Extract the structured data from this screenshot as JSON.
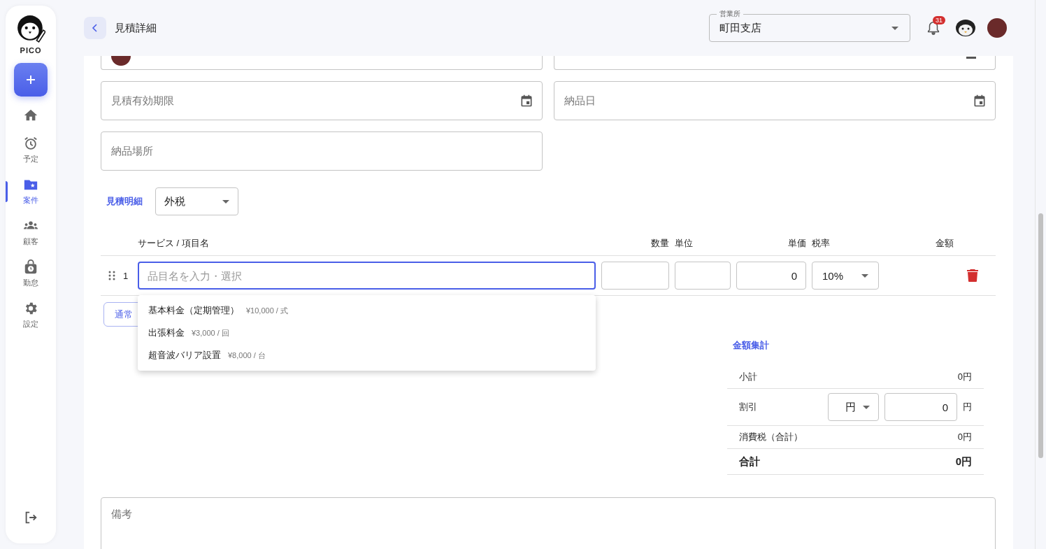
{
  "sidebar": {
    "logo_text": "PICO",
    "nav": [
      {
        "kind": "home",
        "selected": false
      },
      {
        "kind": "alarm",
        "label": "予定",
        "selected": false
      },
      {
        "kind": "folder",
        "label": "案件",
        "selected": true
      },
      {
        "kind": "people",
        "label": "顧客",
        "selected": false
      },
      {
        "kind": "timecard",
        "label": "勤怠",
        "selected": false
      },
      {
        "kind": "gear",
        "label": "設定",
        "selected": false
      }
    ]
  },
  "header": {
    "title": "見積詳細",
    "branch_select": {
      "label": "営業所",
      "value": "町田支店"
    },
    "notification_count": "31"
  },
  "partial_fields": [
    {
      "kind": "person"
    },
    {
      "kind": "date"
    }
  ],
  "fields": [
    {
      "kind": "date",
      "placeholder": "見積有効期限"
    },
    {
      "kind": "date",
      "placeholder": "納品日"
    },
    {
      "kind": "text",
      "placeholder": "納品場所"
    }
  ],
  "line_items": {
    "title": "見積明細",
    "tax_mode": "外税",
    "columns": [
      "サービス / 項目名",
      "数量",
      "単位",
      "単価",
      "税率",
      "金額"
    ],
    "rows": [
      {
        "number": "1",
        "name_placeholder": "品目名を入力・選択",
        "focused": true,
        "unit_price": "0",
        "tax_rate": "10%"
      }
    ],
    "suggestions": [
      {
        "name": "基本料金（定期管理）",
        "price": "¥10,000 / 式"
      },
      {
        "name": "出張料金",
        "price": "¥3,000 / 回"
      },
      {
        "name": "超音波バリア設置",
        "price": "¥8,000 / 台"
      }
    ],
    "add_button": "通常"
  },
  "summary": {
    "title": "金額集計",
    "rows": [
      {
        "kind": "plain",
        "label": "小計",
        "value": "0円"
      },
      {
        "kind": "discount",
        "label": "割引",
        "unit_select": "円",
        "value": "0",
        "unit": "円"
      },
      {
        "kind": "plain",
        "label": "消費税（合計）",
        "value": "0円"
      },
      {
        "kind": "total",
        "label": "合計",
        "value": "0円"
      }
    ]
  },
  "notes": {
    "placeholder": "備考"
  }
}
